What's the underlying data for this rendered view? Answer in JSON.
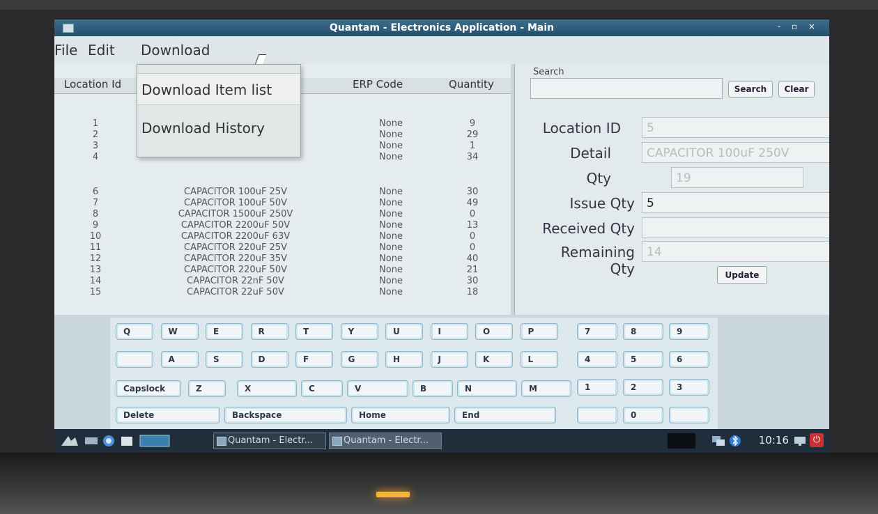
{
  "window": {
    "title": "Quantam - Electronics Application - Main",
    "controls": "- ▫ ×"
  },
  "menu": {
    "file": "File",
    "edit": "Edit",
    "download": "Download"
  },
  "download_menu": {
    "item_list": "Download Item list",
    "history": "Download History"
  },
  "table": {
    "headers": {
      "location_id": "Location Id",
      "erp_code": "ERP Code",
      "quantity": "Quantity"
    },
    "rows": [
      {
        "id": "1",
        "desc": "",
        "erp": "None",
        "qty": "9"
      },
      {
        "id": "2",
        "desc": "",
        "erp": "None",
        "qty": "29"
      },
      {
        "id": "3",
        "desc": "",
        "erp": "None",
        "qty": "1"
      },
      {
        "id": "4",
        "desc": "",
        "erp": "None",
        "qty": "34"
      },
      {
        "id": "6",
        "desc": "CAPACITOR 100uF 25V",
        "erp": "None",
        "qty": "30"
      },
      {
        "id": "7",
        "desc": "CAPACITOR 100uF 50V",
        "erp": "None",
        "qty": "49"
      },
      {
        "id": "8",
        "desc": "CAPACITOR 1500uF 250V",
        "erp": "None",
        "qty": "0"
      },
      {
        "id": "9",
        "desc": "CAPACITOR 2200uF 50V",
        "erp": "None",
        "qty": "13"
      },
      {
        "id": "10",
        "desc": "CAPACITOR 2200uF 63V",
        "erp": "None",
        "qty": "0"
      },
      {
        "id": "11",
        "desc": "CAPACITOR 220uF 25V",
        "erp": "None",
        "qty": "0"
      },
      {
        "id": "12",
        "desc": "CAPACITOR 220uF 35V",
        "erp": "None",
        "qty": "40"
      },
      {
        "id": "13",
        "desc": "CAPACITOR 220uF 50V",
        "erp": "None",
        "qty": "21"
      },
      {
        "id": "14",
        "desc": "CAPACITOR 22nF 50V",
        "erp": "None",
        "qty": "30"
      },
      {
        "id": "15",
        "desc": "CAPACITOR 22uF 50V",
        "erp": "None",
        "qty": "18"
      }
    ]
  },
  "search": {
    "label": "Search",
    "value": "",
    "search_button": "Search",
    "clear_button": "Clear"
  },
  "form": {
    "location_id_label": "Location ID",
    "location_id_value": "5",
    "detail_label": "Detail",
    "detail_value": "CAPACITOR 100uF 250V",
    "qty_label": "Qty",
    "qty_value": "19",
    "issue_qty_label": "Issue Qty",
    "issue_qty_value": "5",
    "received_qty_label": "Received Qty",
    "received_qty_value": "",
    "remaining_qty_label": "Remaining Qty",
    "remaining_qty_value": "14",
    "update_button": "Update"
  },
  "keyboard": {
    "row1": [
      "Q",
      "W",
      "E",
      "R",
      "T",
      "Y",
      "U",
      "I",
      "O",
      "P"
    ],
    "row2": [
      "",
      "A",
      "S",
      "D",
      "F",
      "G",
      "H",
      "J",
      "K",
      "L"
    ],
    "row3": [
      "Capslock",
      "Z",
      "X",
      "C",
      "V",
      "B",
      "N",
      "M"
    ],
    "row4": [
      "Delete",
      "Backspace",
      "Home",
      "End"
    ],
    "numpad": [
      [
        "7",
        "8",
        "9"
      ],
      [
        "4",
        "5",
        "6"
      ],
      [
        "1",
        "2",
        "3"
      ],
      [
        "",
        "0",
        ""
      ]
    ]
  },
  "taskbar": {
    "windows": [
      "Quantam - Electr...",
      "Quantam - Electr..."
    ],
    "time": "10:16",
    "icons": [
      "menu-icon",
      "desktop-icon",
      "browser-icon",
      "files-icon",
      "terminal-icon",
      "network-icon",
      "bluetooth-icon",
      "screen-icon",
      "power-icon"
    ]
  },
  "colors": {
    "titlebar": "#2f5f80",
    "taskbar": "#1f2e3a",
    "keyboard_key_border": "#8fb6cb"
  }
}
